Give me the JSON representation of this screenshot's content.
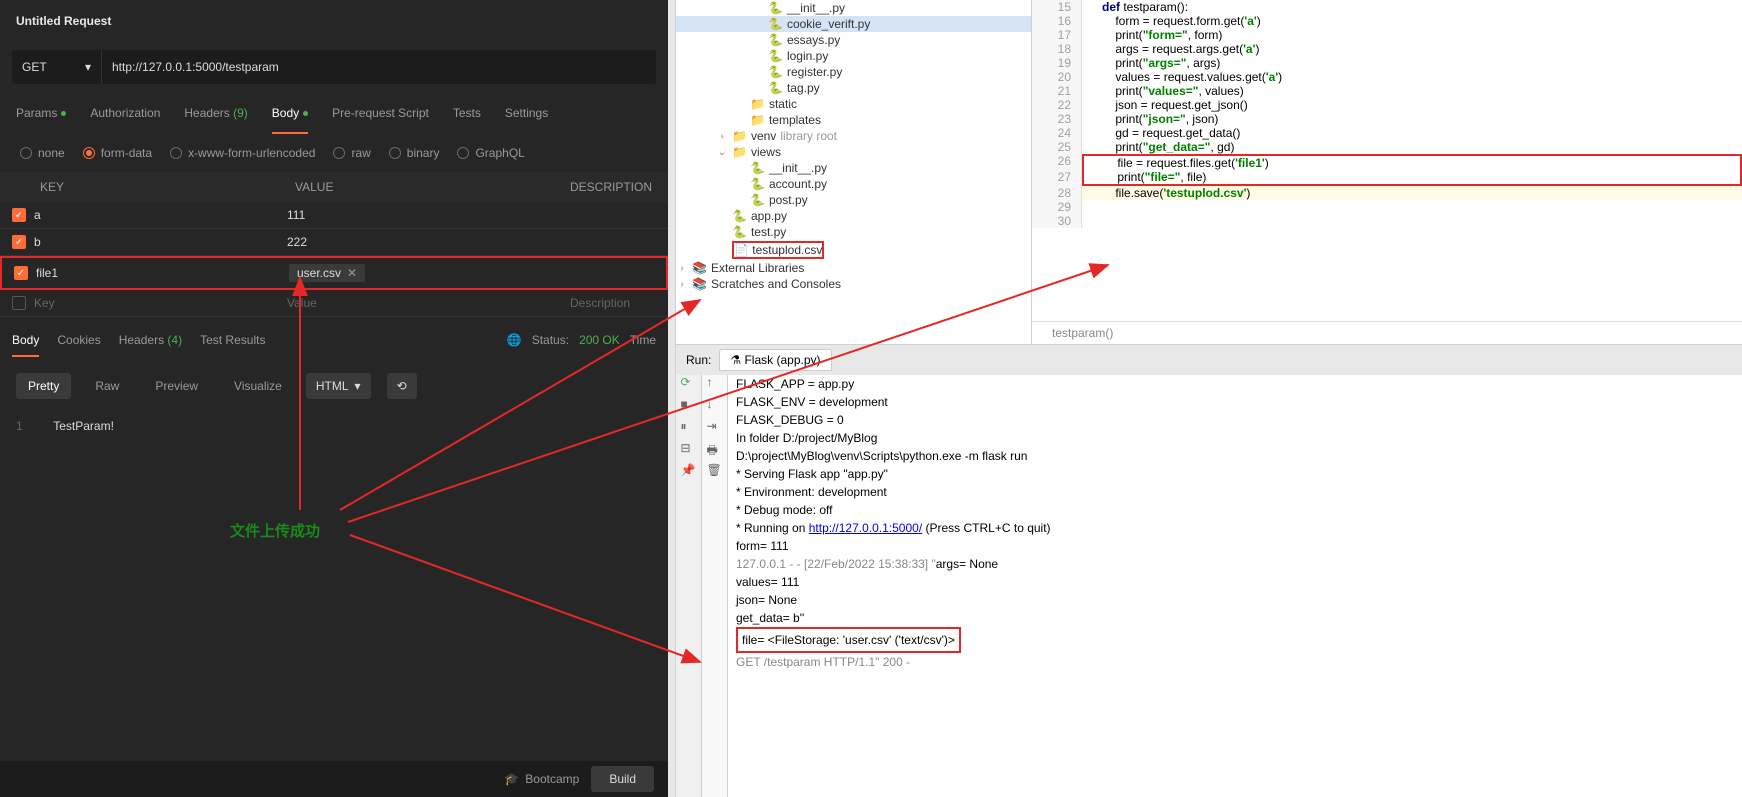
{
  "postman": {
    "title": "Untitled Request",
    "method": "GET",
    "url": "http://127.0.0.1:5000/testparam",
    "tabs": {
      "params": "Params",
      "auth": "Authorization",
      "headers": "Headers",
      "headers_count": "(9)",
      "body": "Body",
      "prerequest": "Pre-request Script",
      "tests": "Tests",
      "settings": "Settings"
    },
    "body_types": {
      "none": "none",
      "formdata": "form-data",
      "urlencoded": "x-www-form-urlencoded",
      "raw": "raw",
      "binary": "binary",
      "graphql": "GraphQL"
    },
    "kv_head": {
      "key": "KEY",
      "value": "VALUE",
      "desc": "DESCRIPTION"
    },
    "kv_rows": [
      {
        "k": "a",
        "v": "111"
      },
      {
        "k": "b",
        "v": "222"
      },
      {
        "k": "file1",
        "v": "user.csv"
      }
    ],
    "placeholders": {
      "key": "Key",
      "value": "Value",
      "desc": "Description"
    },
    "resp_tabs": {
      "body": "Body",
      "cookies": "Cookies",
      "headers": "Headers",
      "headers_count": "(4)",
      "test": "Test Results"
    },
    "resp_status": {
      "label": "Status:",
      "code": "200 OK",
      "time": "Time"
    },
    "fmt": {
      "pretty": "Pretty",
      "raw": "Raw",
      "preview": "Preview",
      "visualize": "Visualize",
      "html": "HTML"
    },
    "resp_body": "TestParam!",
    "bootcamp": "Bootcamp",
    "build": "Build"
  },
  "annotation": "文件上传成功",
  "tree": {
    "items": [
      {
        "name": "__init__.py",
        "indent": 3,
        "type": "py"
      },
      {
        "name": "cookie_verift.py",
        "indent": 3,
        "type": "py",
        "sel": true
      },
      {
        "name": "essays.py",
        "indent": 3,
        "type": "py"
      },
      {
        "name": "login.py",
        "indent": 3,
        "type": "py"
      },
      {
        "name": "register.py",
        "indent": 3,
        "type": "py"
      },
      {
        "name": "tag.py",
        "indent": 3,
        "type": "py"
      },
      {
        "name": "static",
        "indent": 2,
        "type": "folder"
      },
      {
        "name": "templates",
        "indent": 2,
        "type": "folder"
      },
      {
        "name": "venv",
        "suffix": "library root",
        "indent": 1,
        "type": "folder",
        "arrow": ">"
      },
      {
        "name": "views",
        "indent": 1,
        "type": "folder",
        "arrow": "v"
      },
      {
        "name": "__init__.py",
        "indent": 2,
        "type": "py"
      },
      {
        "name": "account.py",
        "indent": 2,
        "type": "py"
      },
      {
        "name": "post.py",
        "indent": 2,
        "type": "py"
      },
      {
        "name": "app.py",
        "indent": 1,
        "type": "py"
      },
      {
        "name": "test.py",
        "indent": 1,
        "type": "py"
      },
      {
        "name": "testuplod.csv",
        "indent": 1,
        "type": "csv",
        "red": true
      },
      {
        "name": "External Libraries",
        "indent": 0,
        "type": "lib",
        "arrow": ">"
      },
      {
        "name": "Scratches and Consoles",
        "indent": 0,
        "type": "scratch",
        "arrow": ">"
      }
    ]
  },
  "code": {
    "lines": [
      {
        "n": 15,
        "html": "<span class='kw'>def</span> testparam():"
      },
      {
        "n": 16,
        "html": "    form = request.form.get(<span class='str'>'a'</span>)"
      },
      {
        "n": 17,
        "html": "    print(<span class='str'>\"form=\"</span>, form)"
      },
      {
        "n": 18,
        "html": "    args = request.args.get(<span class='str'>'a'</span>)"
      },
      {
        "n": 19,
        "html": "    print(<span class='str'>\"args=\"</span>, args)"
      },
      {
        "n": 20,
        "html": "    values = request.values.get(<span class='str'>'a'</span>)"
      },
      {
        "n": 21,
        "html": "    print(<span class='str'>\"values=\"</span>, values)"
      },
      {
        "n": 22,
        "html": "    json = request.get_json()"
      },
      {
        "n": 23,
        "html": "    print(<span class='str'>\"json=\"</span>, json)"
      },
      {
        "n": 24,
        "html": "    gd = request.get_data()"
      },
      {
        "n": 25,
        "html": "    print(<span class='str'>\"get_data=\"</span>, gd)"
      },
      {
        "n": 26,
        "html": "    file = request.files.get(<span class='str'>'file1'</span>)",
        "red": "top"
      },
      {
        "n": 27,
        "html": "    print(<span class='str'>\"file=\"</span>, file)",
        "red": "bot"
      },
      {
        "n": 28,
        "html": "    file.save(<span class='str'>'testuplod.csv'</span>)",
        "hl": true
      },
      {
        "n": 29,
        "html": ""
      },
      {
        "n": 30,
        "html": ""
      }
    ],
    "breadcrumb": "testparam()"
  },
  "run": {
    "label": "Run:",
    "tab": "Flask (app.py)",
    "lines": [
      "FLASK_APP = app.py",
      "FLASK_ENV = development",
      "FLASK_DEBUG = 0",
      "In folder D:/project/MyBlog",
      "D:\\project\\MyBlog\\venv\\Scripts\\python.exe -m flask run",
      " * Serving Flask app \"app.py\"",
      " * Environment: development",
      " * Debug mode: off",
      " * Running on <link>http://127.0.0.1:5000/</link> (Press CTRL+C to quit)",
      "form= 111",
      "<gray>127.0.0.1 - - [22/Feb/2022 15:38:33] \"</gray>args= None",
      "values= 111",
      "json= None",
      "get_data= b''",
      "<red>file= &lt;FileStorage: 'user.csv' ('text/csv')&gt;</red>",
      "<gray>GET /testparam HTTP/1.1\" 200 -</gray>"
    ]
  }
}
